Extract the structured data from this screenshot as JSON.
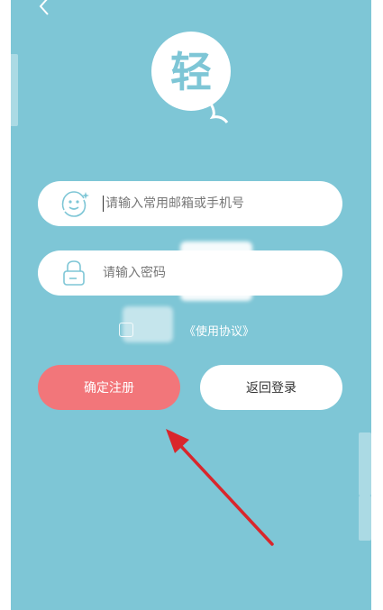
{
  "theme": {
    "background": "#7ec6d6",
    "register_button": "#f2767a",
    "arrow": "#d9262c"
  },
  "header": {
    "back_icon": "chevron-left-icon"
  },
  "logo": {
    "icon": "balloon-logo-icon",
    "glyph": "轻"
  },
  "form": {
    "email": {
      "icon": "smiley-icon",
      "placeholder": "请输入常用邮箱或手机号",
      "value": ""
    },
    "password": {
      "icon": "lock-icon",
      "placeholder": "请输入密码",
      "value": ""
    },
    "agreement_link": "《使用协议》"
  },
  "buttons": {
    "register": "确定注册",
    "back_to_login": "返回登录"
  }
}
